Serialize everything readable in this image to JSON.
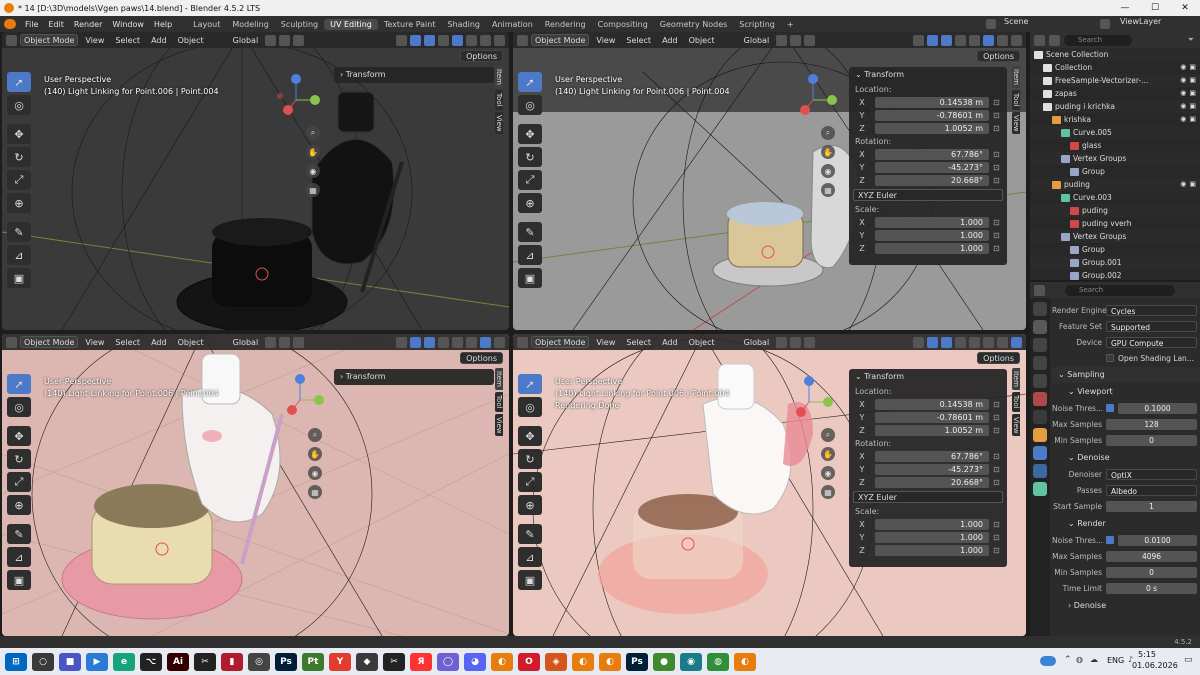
{
  "window": {
    "title": "* 14 [D:\\3D\\models\\Vgen paws\\14.blend] - Blender 4.5.2 LTS",
    "minimize": "—",
    "maximize": "☐",
    "close": "✕"
  },
  "menu": [
    "File",
    "Edit",
    "Render",
    "Window",
    "Help"
  ],
  "workspaces": [
    "Layout",
    "Modeling",
    "Sculpting",
    "UV Editing",
    "Texture Paint",
    "Shading",
    "Animation",
    "Rendering",
    "Compositing",
    "Geometry Nodes",
    "Scripting",
    "+"
  ],
  "active_workspace": "UV Editing",
  "scene": {
    "label": "Scene",
    "view_layer": "ViewLayer"
  },
  "viewport_header": {
    "mode": "Object Mode",
    "view": "View",
    "select": "Select",
    "add": "Add",
    "object": "Object",
    "orientation": "Global",
    "options": "Options"
  },
  "overlay": {
    "perspective": "User Perspective",
    "context": "(140) Light Linking for Point.006 | Point.004",
    "render_status": "Rendering Done"
  },
  "side_tabs": [
    "Item",
    "Tool",
    "View"
  ],
  "transform_panel": {
    "title": "Transform",
    "location_label": "Location:",
    "location": {
      "x": "0.14538 m",
      "y": "-0.78601 m",
      "z": "1.0052 m"
    },
    "rotation_label": "Rotation:",
    "rotation": {
      "x": "67.786°",
      "y": "-45.273°",
      "z": "20.668°"
    },
    "rotation_mode": "XYZ Euler",
    "scale_label": "Scale:",
    "scale": {
      "x": "1.000",
      "y": "1.000",
      "z": "1.000"
    },
    "axes": [
      "X",
      "Y",
      "Z"
    ]
  },
  "outliner": {
    "search_placeholder": "Search",
    "rows": [
      {
        "indent": 0,
        "label": "Scene Collection",
        "icon": "collection-icon",
        "color": "#e0e0e0"
      },
      {
        "indent": 1,
        "label": "Collection",
        "icon": "collection-icon",
        "color": "#e0e0e0"
      },
      {
        "indent": 1,
        "label": "FreeSample-Vectorizer-...",
        "icon": "collection-icon",
        "color": "#e0e0e0"
      },
      {
        "indent": 1,
        "label": "zapas",
        "icon": "collection-icon",
        "color": "#e0e0e0"
      },
      {
        "indent": 1,
        "label": "puding i krichka",
        "icon": "collection-icon",
        "color": "#e0e0e0"
      },
      {
        "indent": 2,
        "label": "krishka",
        "icon": "object-icon",
        "color": "#e39c41"
      },
      {
        "indent": 3,
        "label": "Curve.005",
        "icon": "curve-data-icon",
        "color": "#5fc3a1"
      },
      {
        "indent": 4,
        "label": "glass",
        "icon": "material-icon",
        "color": "#d04848"
      },
      {
        "indent": 3,
        "label": "Vertex Groups",
        "icon": "vertex-groups-icon",
        "color": "#9aa6c9"
      },
      {
        "indent": 4,
        "label": "Group",
        "icon": "vertex-group-icon",
        "color": "#9aa6c9"
      },
      {
        "indent": 2,
        "label": "puding",
        "icon": "object-icon",
        "color": "#e39c41"
      },
      {
        "indent": 3,
        "label": "Curve.003",
        "icon": "curve-data-icon",
        "color": "#5fc3a1"
      },
      {
        "indent": 4,
        "label": "puding",
        "icon": "material-icon",
        "color": "#d04848"
      },
      {
        "indent": 4,
        "label": "puding vverh",
        "icon": "material-icon",
        "color": "#d04848"
      },
      {
        "indent": 3,
        "label": "Vertex Groups",
        "icon": "vertex-groups-icon",
        "color": "#9aa6c9"
      },
      {
        "indent": 4,
        "label": "Group",
        "icon": "vertex-group-icon",
        "color": "#9aa6c9"
      },
      {
        "indent": 4,
        "label": "Group.001",
        "icon": "vertex-group-icon",
        "color": "#9aa6c9"
      },
      {
        "indent": 4,
        "label": "Group.002",
        "icon": "vertex-group-icon",
        "color": "#9aa6c9"
      }
    ]
  },
  "properties": {
    "search_placeholder": "Search",
    "render_engine": {
      "label": "Render Engine",
      "value": "Cycles"
    },
    "feature_set": {
      "label": "Feature Set",
      "value": "Supported"
    },
    "device": {
      "label": "Device",
      "value": "GPU Compute"
    },
    "open_shading": "Open Shading Lan...",
    "sampling": "Sampling",
    "viewport": "Viewport",
    "vp_noise": {
      "label": "Noise Thres...",
      "value": "0.1000"
    },
    "vp_max": {
      "label": "Max Samples",
      "value": "128"
    },
    "vp_min": {
      "label": "Min Samples",
      "value": "0"
    },
    "denoise": "Denoise",
    "denoiser": {
      "label": "Denoiser",
      "value": "OptiX"
    },
    "passes": {
      "label": "Passes",
      "value": "Albedo"
    },
    "start_sample": {
      "label": "Start Sample",
      "value": "1"
    },
    "render": "Render",
    "r_noise": {
      "label": "Noise Thres...",
      "value": "0.0100"
    },
    "r_max": {
      "label": "Max Samples",
      "value": "4096"
    },
    "r_min": {
      "label": "Min Samples",
      "value": "0"
    },
    "time_limit": {
      "label": "Time Limit",
      "value": "0 s"
    },
    "denoise2": "Denoise"
  },
  "status": {
    "version": "4.5.2"
  },
  "taskbar": {
    "lang": "ENG",
    "time": "5:15",
    "date": "01.06.2026",
    "apps": [
      {
        "name": "windows-start-icon",
        "color": "#0067c0",
        "glyph": "⊞"
      },
      {
        "name": "search-taskbar-icon",
        "color": "#3a3a3a",
        "glyph": "○"
      },
      {
        "name": "save-app-icon",
        "color": "#4a56c5",
        "glyph": "■"
      },
      {
        "name": "video-app-icon",
        "color": "#2a7ad6",
        "glyph": "▶"
      },
      {
        "name": "edge-icon",
        "color": "#17a47a",
        "glyph": "e"
      },
      {
        "name": "github-icon",
        "color": "#222222",
        "glyph": "⌥"
      },
      {
        "name": "illustrator-icon",
        "color": "#330000",
        "glyph": "Ai"
      },
      {
        "name": "capcut-icon",
        "color": "#222222",
        "glyph": "✂"
      },
      {
        "name": "notes-app-icon",
        "color": "#b01c2e",
        "glyph": "▮"
      },
      {
        "name": "settings-app-icon",
        "color": "#444444",
        "glyph": "◎"
      },
      {
        "name": "photoshop-icon",
        "color": "#001e36",
        "glyph": "Ps"
      },
      {
        "name": "pt-app-icon",
        "color": "#3d7a2c",
        "glyph": "Pt"
      },
      {
        "name": "yandex-browser-icon",
        "color": "#e33b2e",
        "glyph": "Y"
      },
      {
        "name": "brush-app-icon",
        "color": "#3a3a3a",
        "glyph": "◆"
      },
      {
        "name": "capcut2-icon",
        "color": "#222222",
        "glyph": "✂"
      },
      {
        "name": "yandex-icon",
        "color": "#ff3333",
        "glyph": "Я"
      },
      {
        "name": "messenger-icon",
        "color": "#7060d0",
        "glyph": "◯"
      },
      {
        "name": "discord-icon",
        "color": "#5865f2",
        "glyph": "◕"
      },
      {
        "name": "blender-icon",
        "color": "#e87d0d",
        "glyph": "◐"
      },
      {
        "name": "opera-icon",
        "color": "#d11a2a",
        "glyph": "O"
      },
      {
        "name": "app-icon-a",
        "color": "#d4561c",
        "glyph": "◈"
      },
      {
        "name": "blender-icon-2",
        "color": "#e87d0d",
        "glyph": "◐"
      },
      {
        "name": "blender-icon-3",
        "color": "#e87d0d",
        "glyph": "◐"
      },
      {
        "name": "photoshop-icon-2",
        "color": "#001e36",
        "glyph": "Ps"
      },
      {
        "name": "app-icon-b",
        "color": "#3e8b2f",
        "glyph": "●"
      },
      {
        "name": "app-icon-c",
        "color": "#1a7c8a",
        "glyph": "◉"
      },
      {
        "name": "chrome-icon",
        "color": "#2f8f3a",
        "glyph": "◍"
      },
      {
        "name": "blender-icon-4",
        "color": "#e87d0d",
        "glyph": "◐"
      }
    ]
  },
  "colors": {
    "accent": "#4d79c9",
    "panel": "#2b2b2b",
    "header": "#303030"
  }
}
